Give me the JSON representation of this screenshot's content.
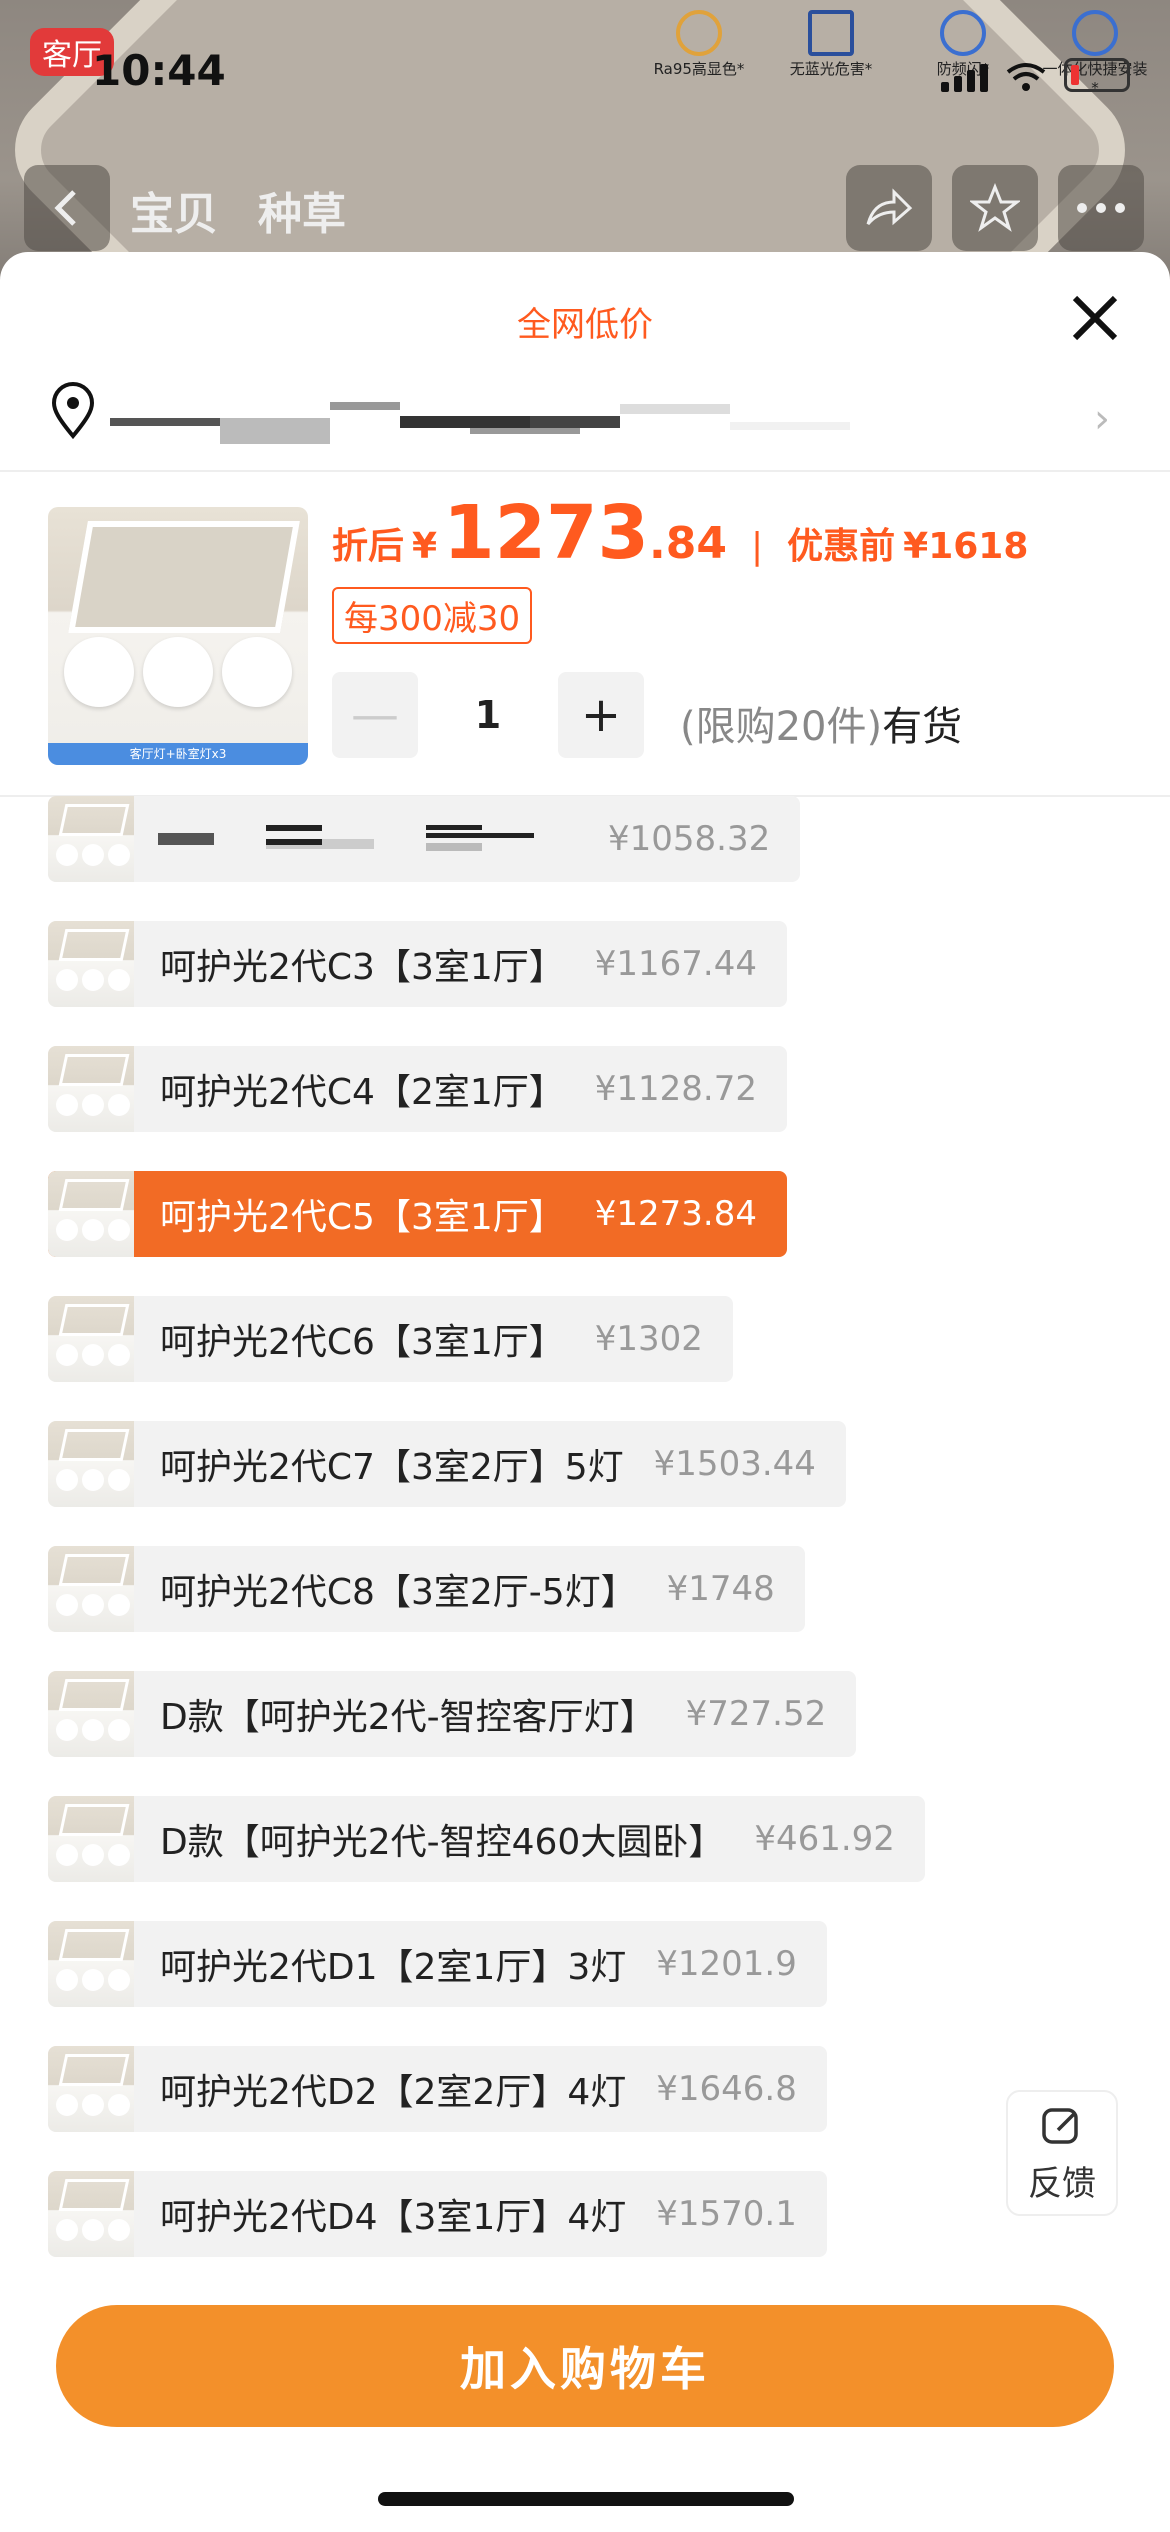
{
  "status_bar": {
    "time": "10:44",
    "room_tag": "客厅"
  },
  "top_badges": [
    "Ra95高显色*",
    "无蓝光危害*",
    "防频闪*",
    "一体化快捷安装*"
  ],
  "nav_tabs": [
    "宝贝",
    "种草"
  ],
  "sheet": {
    "title": "全网低价",
    "product": {
      "image_band_text": "客厅灯+卧室灯x3"
    },
    "price": {
      "after_discount_label": "折后",
      "currency": "¥",
      "integer_part": "1273",
      "decimal_part": ".84",
      "separator": "|",
      "before_label": "优惠前",
      "before_price": "¥1618"
    },
    "promo": "每300减30",
    "quantity": {
      "minus": "—",
      "value": "1",
      "plus": "+"
    },
    "stock": {
      "limit": "(限购20件)",
      "status": "有货"
    }
  },
  "options": [
    {
      "name": "",
      "price": "¥1058.32",
      "selected": false
    },
    {
      "name": "呵护光2代C3【3室1厅】",
      "price": "¥1167.44",
      "selected": false
    },
    {
      "name": "呵护光2代C4【2室1厅】",
      "price": "¥1128.72",
      "selected": false
    },
    {
      "name": "呵护光2代C5【3室1厅】",
      "price": "¥1273.84",
      "selected": true
    },
    {
      "name": "呵护光2代C6【3室1厅】",
      "price": "¥1302",
      "selected": false
    },
    {
      "name": "呵护光2代C7【3室2厅】5灯",
      "price": "¥1503.44",
      "selected": false
    },
    {
      "name": "呵护光2代C8【3室2厅-5灯】",
      "price": "¥1748",
      "selected": false
    },
    {
      "name": "D款【呵护光2代-智控客厅灯】",
      "price": "¥727.52",
      "selected": false
    },
    {
      "name": "D款【呵护光2代-智控460大圆卧】",
      "price": "¥461.92",
      "selected": false
    },
    {
      "name": "呵护光2代D1【2室1厅】3灯",
      "price": "¥1201.9",
      "selected": false
    },
    {
      "name": "呵护光2代D2【2室2厅】4灯",
      "price": "¥1646.8",
      "selected": false
    },
    {
      "name": "呵护光2代D4【3室1厅】4灯",
      "price": "¥1570.1",
      "selected": false
    }
  ],
  "feedback_label": "反馈",
  "add_to_cart": "加入购物车",
  "colors": {
    "accent": "#ff5a1f",
    "selected_bg": "#f26b25",
    "cart_button": "#f3902a"
  }
}
